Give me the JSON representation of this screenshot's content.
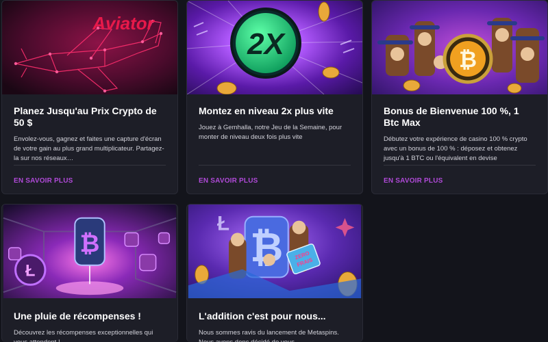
{
  "cards": [
    {
      "art_logo": "Aviator",
      "title": "Planez Jusqu'au Prix Crypto de 50 $",
      "description": "Envolez-vous, gagnez et faites une capture d'écran de votre gain au plus grand multiplicateur. Partagez-la sur nos réseaux…",
      "link": "EN SAVOIR PLUS",
      "icon": "airplane-icon"
    },
    {
      "art_logo": "2X",
      "title": "Montez en niveau 2x plus vite",
      "description": "Jouez à Gemhalla, notre Jeu de la Semaine, pour monter de niveau deux fois plus vite",
      "link": "EN SAVOIR PLUS",
      "icon": "multiplier-icon"
    },
    {
      "title": "Bonus de Bienvenue 100 %, 1 Btc Max",
      "description": "Débutez votre expérience de casino 100 % crypto avec un bonus de 100 % : déposez et obtenez jusqu'à 1 BTC ou l'équivalent en devise",
      "link": "EN SAVOIR PLUS",
      "icon": "bitcoin-icon"
    },
    {
      "title": "Une pluie de récompenses !",
      "description": "Découvrez les récompenses exceptionnelles qui vous attendent !",
      "icon": "bitcoin-icon"
    },
    {
      "art_badge": "ZERO\nFRAIS",
      "title": "L'addition c'est pour nous...",
      "description": "Nous sommes ravis du lancement de Metaspins. Nous avons donc décidé de vous",
      "icon": "bitcoin-icon"
    }
  ],
  "colors": {
    "page_bg": "#13141b",
    "card_bg": "#1d1e27",
    "link": "#b04ad8",
    "aviator_red": "#e8194a"
  }
}
